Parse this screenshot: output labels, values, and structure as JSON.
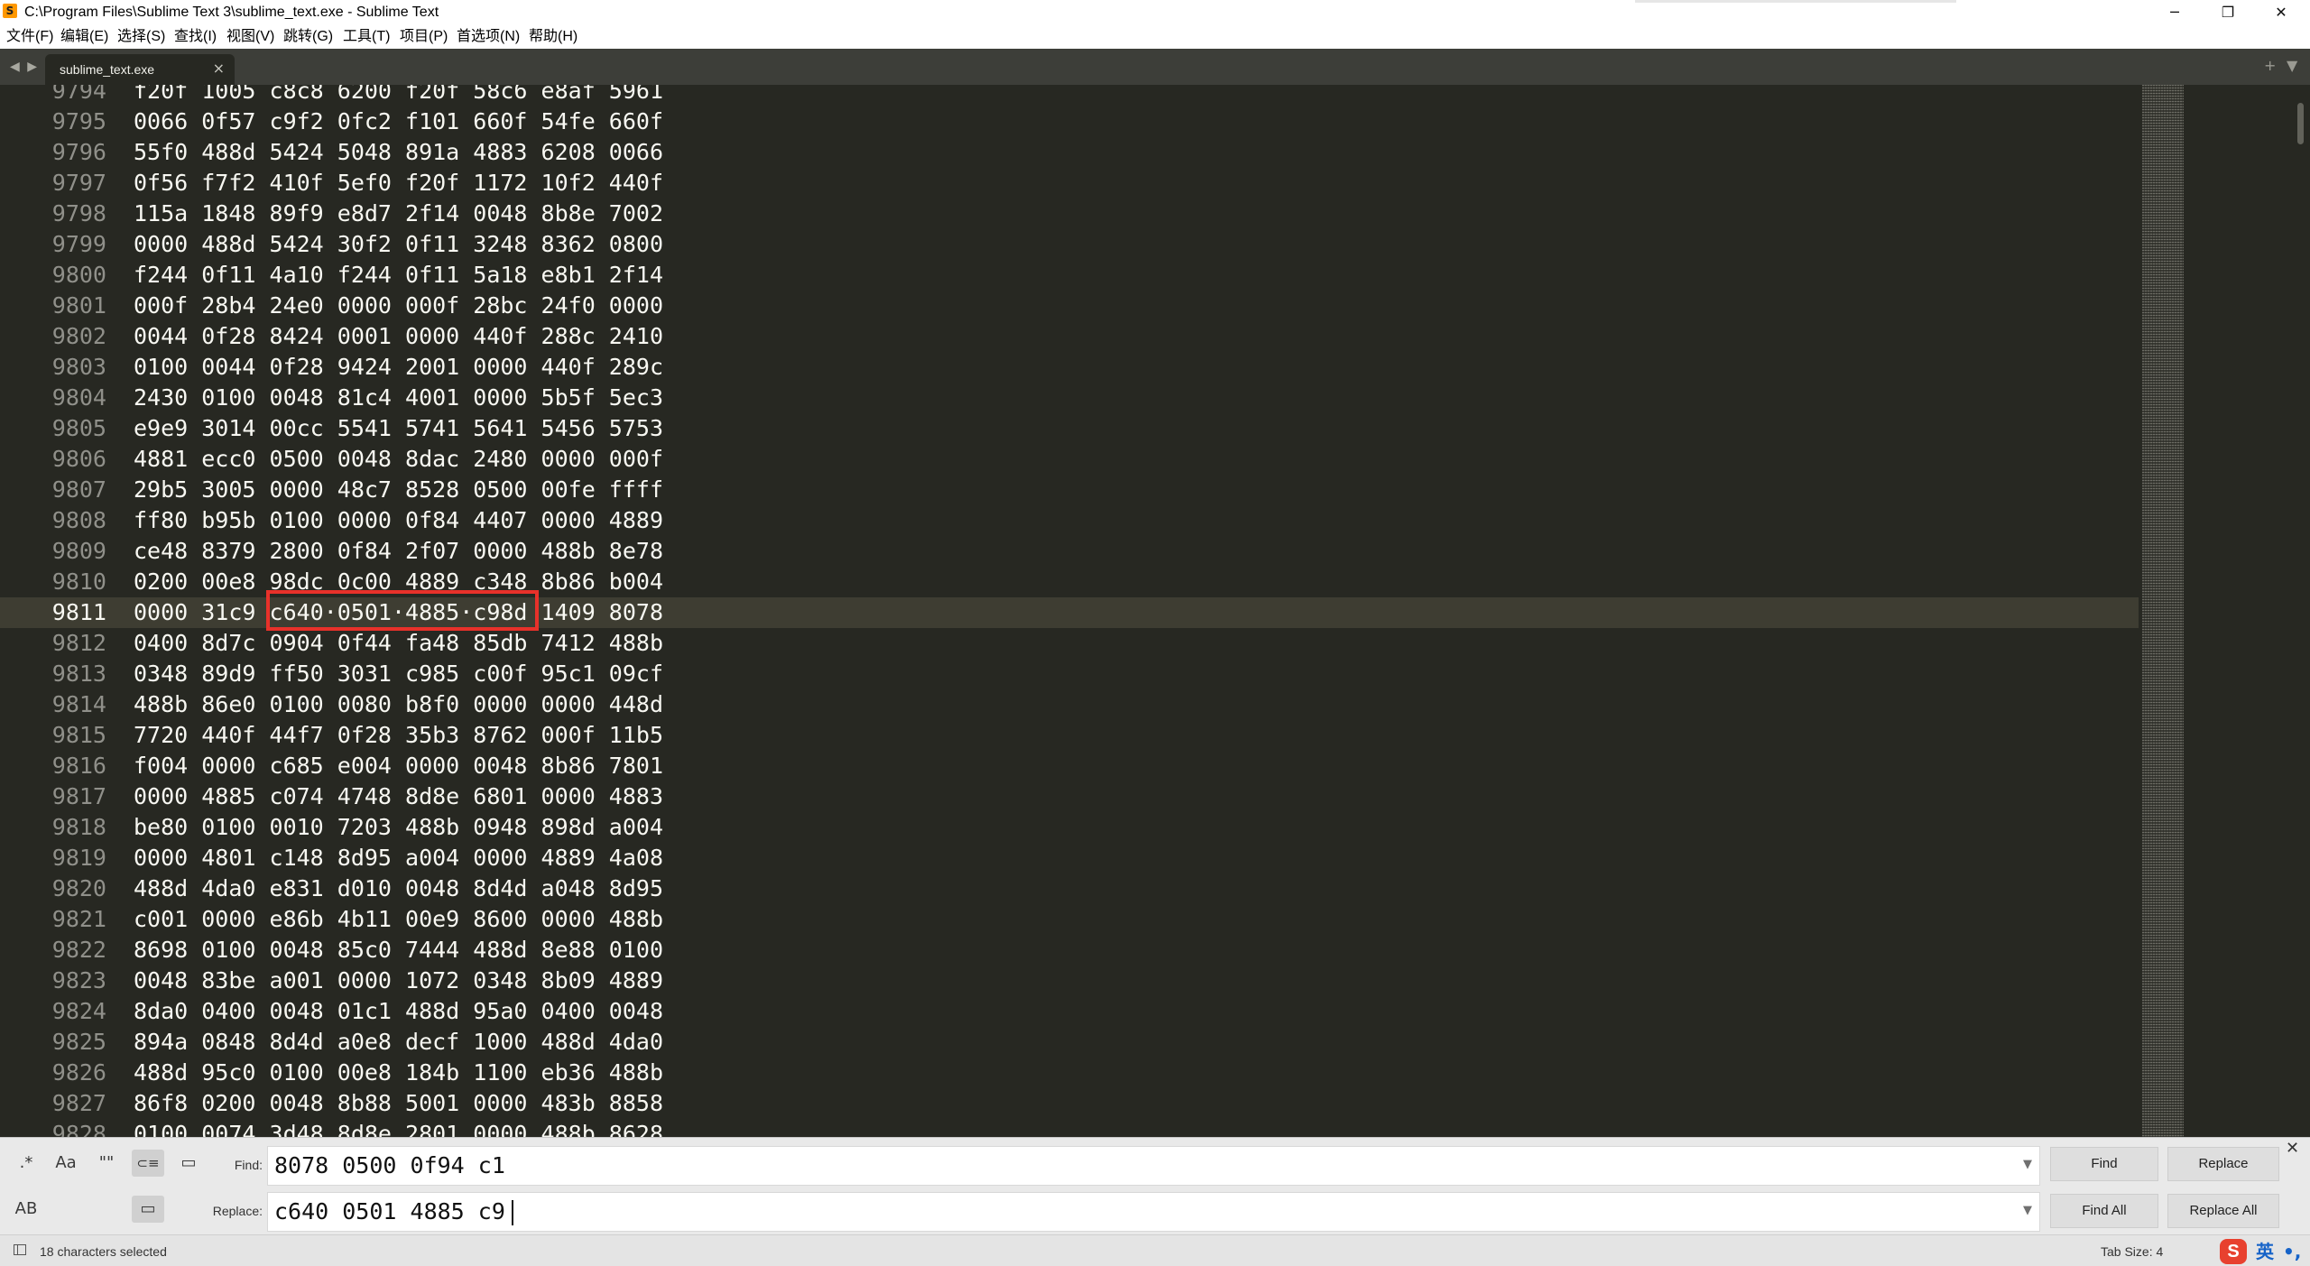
{
  "window": {
    "title": "C:\\Program Files\\Sublime Text 3\\sublime_text.exe - Sublime Text",
    "app_icon": "S",
    "controls": {
      "minimize": "─",
      "maximize": "❐",
      "close": "✕"
    }
  },
  "menu": [
    "文件(F)",
    "编辑(E)",
    "选择(S)",
    "查找(I)",
    "视图(V)",
    "跳转(G)",
    "工具(T)",
    "项目(P)",
    "首选项(N)",
    "帮助(H)"
  ],
  "tabs": {
    "nav_arrows": "◀ ▶",
    "active_tab": "sublime_text.exe",
    "close_glyph": "×",
    "new_tab_glyph": "+",
    "tab_list_glyph": "▼"
  },
  "editor": {
    "current_line": "9811",
    "lines": [
      {
        "num": "9794",
        "text": "f20f 1005 c8c8 6200 f20f 58c6 e8af 5961"
      },
      {
        "num": "9795",
        "text": "0066 0f57 c9f2 0fc2 f101 660f 54fe 660f"
      },
      {
        "num": "9796",
        "text": "55f0 488d 5424 5048 891a 4883 6208 0066"
      },
      {
        "num": "9797",
        "text": "0f56 f7f2 410f 5ef0 f20f 1172 10f2 440f"
      },
      {
        "num": "9798",
        "text": "115a 1848 89f9 e8d7 2f14 0048 8b8e 7002"
      },
      {
        "num": "9799",
        "text": "0000 488d 5424 30f2 0f11 3248 8362 0800"
      },
      {
        "num": "9800",
        "text": "f244 0f11 4a10 f244 0f11 5a18 e8b1 2f14"
      },
      {
        "num": "9801",
        "text": "000f 28b4 24e0 0000 000f 28bc 24f0 0000"
      },
      {
        "num": "9802",
        "text": "0044 0f28 8424 0001 0000 440f 288c 2410"
      },
      {
        "num": "9803",
        "text": "0100 0044 0f28 9424 2001 0000 440f 289c"
      },
      {
        "num": "9804",
        "text": "2430 0100 0048 81c4 4001 0000 5b5f 5ec3"
      },
      {
        "num": "9805",
        "text": "e9e9 3014 00cc 5541 5741 5641 5456 5753"
      },
      {
        "num": "9806",
        "text": "4881 ecc0 0500 0048 8dac 2480 0000 000f"
      },
      {
        "num": "9807",
        "text": "29b5 3005 0000 48c7 8528 0500 00fe ffff"
      },
      {
        "num": "9808",
        "text": "ff80 b95b 0100 0000 0f84 4407 0000 4889"
      },
      {
        "num": "9809",
        "text": "ce48 8379 2800 0f84 2f07 0000 488b 8e78"
      },
      {
        "num": "9810",
        "text": "0200 00e8 98dc 0c00 4889 c348 8b86 b004"
      },
      {
        "num": "9811",
        "text": "0000 31c9 c640·0501·4885·c98d 1409 8078"
      },
      {
        "num": "9812",
        "text": "0400 8d7c 0904 0f44 fa48 85db 7412 488b"
      },
      {
        "num": "9813",
        "text": "0348 89d9 ff50 3031 c985 c00f 95c1 09cf"
      },
      {
        "num": "9814",
        "text": "488b 86e0 0100 0080 b8f0 0000 0000 448d"
      },
      {
        "num": "9815",
        "text": "7720 440f 44f7 0f28 35b3 8762 000f 11b5"
      },
      {
        "num": "9816",
        "text": "f004 0000 c685 e004 0000 0048 8b86 7801"
      },
      {
        "num": "9817",
        "text": "0000 4885 c074 4748 8d8e 6801 0000 4883"
      },
      {
        "num": "9818",
        "text": "be80 0100 0010 7203 488b 0948 898d a004"
      },
      {
        "num": "9819",
        "text": "0000 4801 c148 8d95 a004 0000 4889 4a08"
      },
      {
        "num": "9820",
        "text": "488d 4da0 e831 d010 0048 8d4d a048 8d95"
      },
      {
        "num": "9821",
        "text": "c001 0000 e86b 4b11 00e9 8600 0000 488b"
      },
      {
        "num": "9822",
        "text": "8698 0100 0048 85c0 7444 488d 8e88 0100"
      },
      {
        "num": "9823",
        "text": "0048 83be a001 0000 1072 0348 8b09 4889"
      },
      {
        "num": "9824",
        "text": "8da0 0400 0048 01c1 488d 95a0 0400 0048"
      },
      {
        "num": "9825",
        "text": "894a 0848 8d4d a0e8 decf 1000 488d 4da0"
      },
      {
        "num": "9826",
        "text": "488d 95c0 0100 00e8 184b 1100 eb36 488b"
      },
      {
        "num": "9827",
        "text": "86f8 0200 0048 8b88 5001 0000 483b 8858"
      },
      {
        "num": "9828",
        "text": "0100 0074 3d48 8d8e 2801 0000 488b 8628"
      }
    ]
  },
  "find_panel": {
    "options": {
      "regex": ".*",
      "case": "Aa",
      "whole_word": "\"\"",
      "wrap": "⊂≡",
      "in_selection": "▭",
      "preserve_case": "AB",
      "highlight": "▭"
    },
    "find_label": "Find:",
    "find_value": "8078 0500 0f94 c1",
    "replace_label": "Replace:",
    "replace_value": "c640 0501 4885 c9",
    "dropdown_glyph": "▼",
    "buttons": {
      "find": "Find",
      "replace": "Replace",
      "find_all": "Find All",
      "replace_all": "Replace All"
    },
    "close_glyph": "✕"
  },
  "status_bar": {
    "selection": "18 characters selected",
    "tab_size": "Tab Size: 4",
    "ime": {
      "logo": "S",
      "lang": "英",
      "punct": "•,"
    }
  }
}
